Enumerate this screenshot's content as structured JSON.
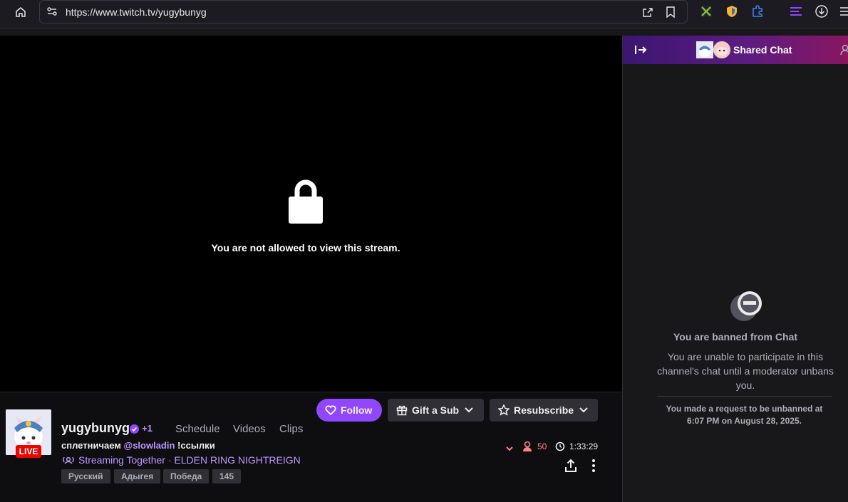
{
  "browser": {
    "url": "https://www.twitch.tv/yugybunyg",
    "colors": {
      "bar": "#1c1b22"
    }
  },
  "player": {
    "message": "You are not allowed to view this stream."
  },
  "channel": {
    "name": "yugybunyg",
    "extra_count": "+1",
    "live_badge": "LIVE",
    "nav": [
      "Schedule",
      "Videos",
      "Clips"
    ],
    "title_prefix": "сплетничаем ",
    "title_mention": "@slowladin",
    "title_suffix": " !ссылки",
    "together_label": "Streaming Together",
    "together_sep": " · ",
    "game": "ELDEN RING NIGHTREIGN",
    "tags": [
      "Русский",
      "Адыгея",
      "Победа",
      "145"
    ],
    "viewers": "50",
    "uptime": "1:33:29"
  },
  "actions": {
    "follow": "Follow",
    "gift": "Gift a Sub",
    "resub": "Resubscribe",
    "accent": "#9147ff"
  },
  "chat": {
    "title": "Shared Chat",
    "ban_title": "You are banned from Chat",
    "ban_desc": "You are unable to participate in this channel's chat until a moderator unbans you.",
    "ban_request": "You made a request to be unbanned at 6:07 PM on August 28, 2025."
  }
}
